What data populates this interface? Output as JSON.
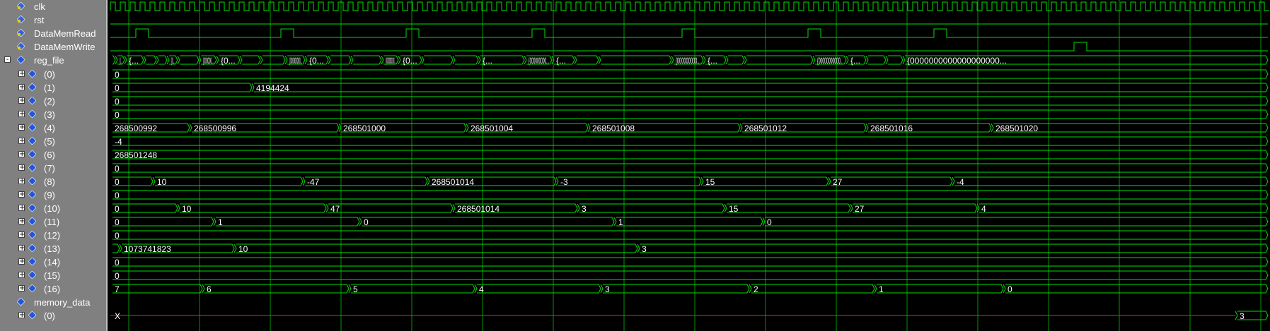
{
  "colors": {
    "wave": "#00e000",
    "grid": "#00b000",
    "panel": "#808080",
    "diamond": "#2255dd",
    "xline": "#ff2020"
  },
  "signals": [
    {
      "id": "clk",
      "label": "clk",
      "kind": "clock",
      "indent": 0,
      "expander": "",
      "icon": "diamond-yellow-icon"
    },
    {
      "id": "rst",
      "label": "rst",
      "kind": "level",
      "indent": 0,
      "expander": "",
      "icon": "diamond-yellow-icon"
    },
    {
      "id": "dmr",
      "label": "DataMemRead",
      "kind": "pulse",
      "indent": 0,
      "expander": "",
      "icon": "diamond-yellow-icon"
    },
    {
      "id": "dmw",
      "label": "DataMemWrite",
      "kind": "pulse",
      "indent": 0,
      "expander": "",
      "icon": "diamond-yellow-icon"
    },
    {
      "id": "rf",
      "label": "reg_file",
      "kind": "bus",
      "indent": 0,
      "expander": "-",
      "icon": "diamond-blue-icon"
    },
    {
      "id": "r0",
      "label": "(0)",
      "kind": "bus",
      "indent": 1,
      "expander": "+",
      "icon": "diamond-blue-icon"
    },
    {
      "id": "r1",
      "label": "(1)",
      "kind": "bus",
      "indent": 1,
      "expander": "+",
      "icon": "diamond-blue-icon"
    },
    {
      "id": "r2",
      "label": "(2)",
      "kind": "bus",
      "indent": 1,
      "expander": "+",
      "icon": "diamond-blue-icon"
    },
    {
      "id": "r3",
      "label": "(3)",
      "kind": "bus",
      "indent": 1,
      "expander": "+",
      "icon": "diamond-blue-icon"
    },
    {
      "id": "r4",
      "label": "(4)",
      "kind": "bus",
      "indent": 1,
      "expander": "+",
      "icon": "diamond-blue-icon"
    },
    {
      "id": "r5",
      "label": "(5)",
      "kind": "bus",
      "indent": 1,
      "expander": "+",
      "icon": "diamond-blue-icon"
    },
    {
      "id": "r6",
      "label": "(6)",
      "kind": "bus",
      "indent": 1,
      "expander": "+",
      "icon": "diamond-blue-icon"
    },
    {
      "id": "r7",
      "label": "(7)",
      "kind": "bus",
      "indent": 1,
      "expander": "+",
      "icon": "diamond-blue-icon"
    },
    {
      "id": "r8",
      "label": "(8)",
      "kind": "bus",
      "indent": 1,
      "expander": "+",
      "icon": "diamond-blue-icon"
    },
    {
      "id": "r9",
      "label": "(9)",
      "kind": "bus",
      "indent": 1,
      "expander": "+",
      "icon": "diamond-blue-icon"
    },
    {
      "id": "r10",
      "label": "(10)",
      "kind": "bus",
      "indent": 1,
      "expander": "+",
      "icon": "diamond-blue-icon"
    },
    {
      "id": "r11",
      "label": "(11)",
      "kind": "bus",
      "indent": 1,
      "expander": "+",
      "icon": "diamond-blue-icon"
    },
    {
      "id": "r12",
      "label": "(12)",
      "kind": "bus",
      "indent": 1,
      "expander": "+",
      "icon": "diamond-blue-icon"
    },
    {
      "id": "r13",
      "label": "(13)",
      "kind": "bus",
      "indent": 1,
      "expander": "+",
      "icon": "diamond-blue-icon"
    },
    {
      "id": "r14",
      "label": "(14)",
      "kind": "bus",
      "indent": 1,
      "expander": "+",
      "icon": "diamond-blue-icon"
    },
    {
      "id": "r15",
      "label": "(15)",
      "kind": "bus",
      "indent": 1,
      "expander": "+",
      "icon": "diamond-blue-icon"
    },
    {
      "id": "r16",
      "label": "(16)",
      "kind": "bus",
      "indent": 1,
      "expander": "+",
      "icon": "diamond-blue-icon"
    },
    {
      "id": "md",
      "label": "memory_data",
      "kind": "none",
      "indent": 0,
      "expander": "",
      "icon": "diamond-blue-icon"
    },
    {
      "id": "md0",
      "label": "(0)",
      "kind": "bus",
      "indent": 1,
      "expander": "+",
      "icon": "diamond-blue-icon"
    }
  ],
  "values": {
    "rf": [
      "",
      "{0...",
      "{...",
      "",
      "",
      "{0...",
      "",
      "{000000...",
      "{0...",
      "",
      "",
      "{000000000...",
      "{0...",
      "",
      "",
      "{00000000000...",
      "{0...",
      "",
      "",
      "{...",
      "{000000000...",
      "{...",
      "",
      "",
      "{000000000...",
      "{...",
      "",
      "",
      "{00000000000...",
      "{...",
      "",
      "",
      "{0000000000000000000..."
    ],
    "r0": [
      "0"
    ],
    "r1": [
      "0",
      "4194424"
    ],
    "r2": [
      "0"
    ],
    "r3": [
      "0"
    ],
    "r4": [
      "268500992",
      "268500996",
      "268501000",
      "268501004",
      "268501008",
      "268501012",
      "268501016",
      "268501020"
    ],
    "r5": [
      "-4"
    ],
    "r6": [
      "268501248"
    ],
    "r7": [
      "0"
    ],
    "r8": [
      "0",
      "10",
      "-47",
      "268501014",
      "-3",
      "15",
      "27",
      "-4"
    ],
    "r9": [
      "0"
    ],
    "r10": [
      "0",
      "10",
      "47",
      "268501014",
      "3",
      "15",
      "27",
      "4"
    ],
    "r11": [
      "0",
      "1",
      "0",
      "1",
      "0"
    ],
    "r12": [
      "0"
    ],
    "r13": [
      "",
      "1073741823",
      "10",
      "3"
    ],
    "r14": [
      "0"
    ],
    "r15": [
      "0"
    ],
    "r16": [
      "7",
      "6",
      "5",
      "4",
      "3",
      "2",
      "1",
      "0"
    ],
    "md0": [
      "X",
      "3"
    ]
  }
}
